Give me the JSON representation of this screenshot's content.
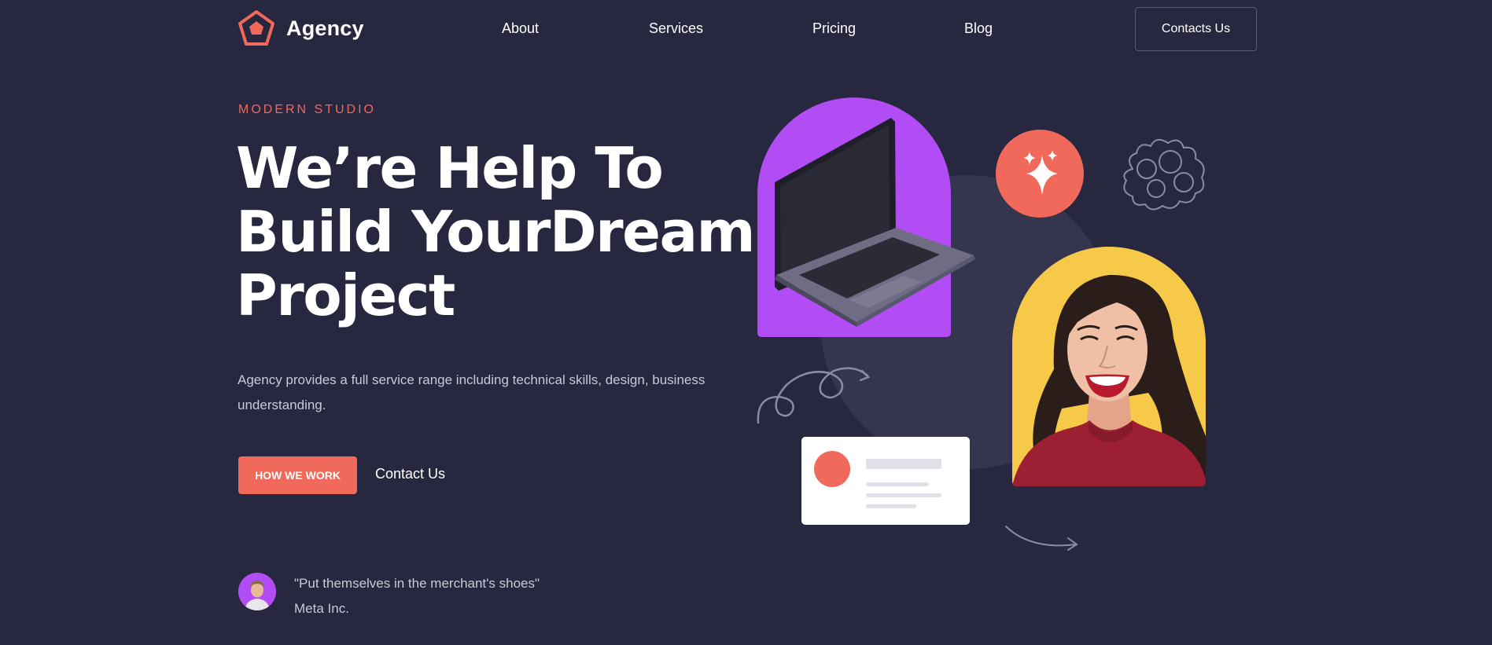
{
  "brand": {
    "name": "Agency",
    "logo_icon": "pentagon-logo-icon",
    "accent_color": "#f0695a"
  },
  "nav": {
    "items": [
      {
        "label": "About"
      },
      {
        "label": "Services"
      },
      {
        "label": "Pricing"
      },
      {
        "label": "Blog"
      }
    ],
    "cta_label": "Contacts Us"
  },
  "hero": {
    "eyebrow": "MODERN STUDIO",
    "headline_lines": [
      "We’re Help To",
      "Build YourDream",
      "Project"
    ],
    "description": "Agency provides a full service range including technical skills, design, business understanding.",
    "primary_button": "HOW WE WORK",
    "secondary_button": "Contact Us"
  },
  "testimonial": {
    "quote": "\"Put themselves in the merchant's shoes\"",
    "author": "Meta Inc."
  },
  "illustration": {
    "icons": [
      "laptop-illustration",
      "sparkle-icon",
      "cloud-doodle-icon",
      "swirl-doodle-icon",
      "arrow-doodle-icon",
      "profile-card-illustration",
      "woman-portrait-illustration"
    ],
    "colors": {
      "purple": "#b24df5",
      "yellow": "#f7c948",
      "coral": "#f0695a",
      "circle": "#35354f"
    }
  }
}
